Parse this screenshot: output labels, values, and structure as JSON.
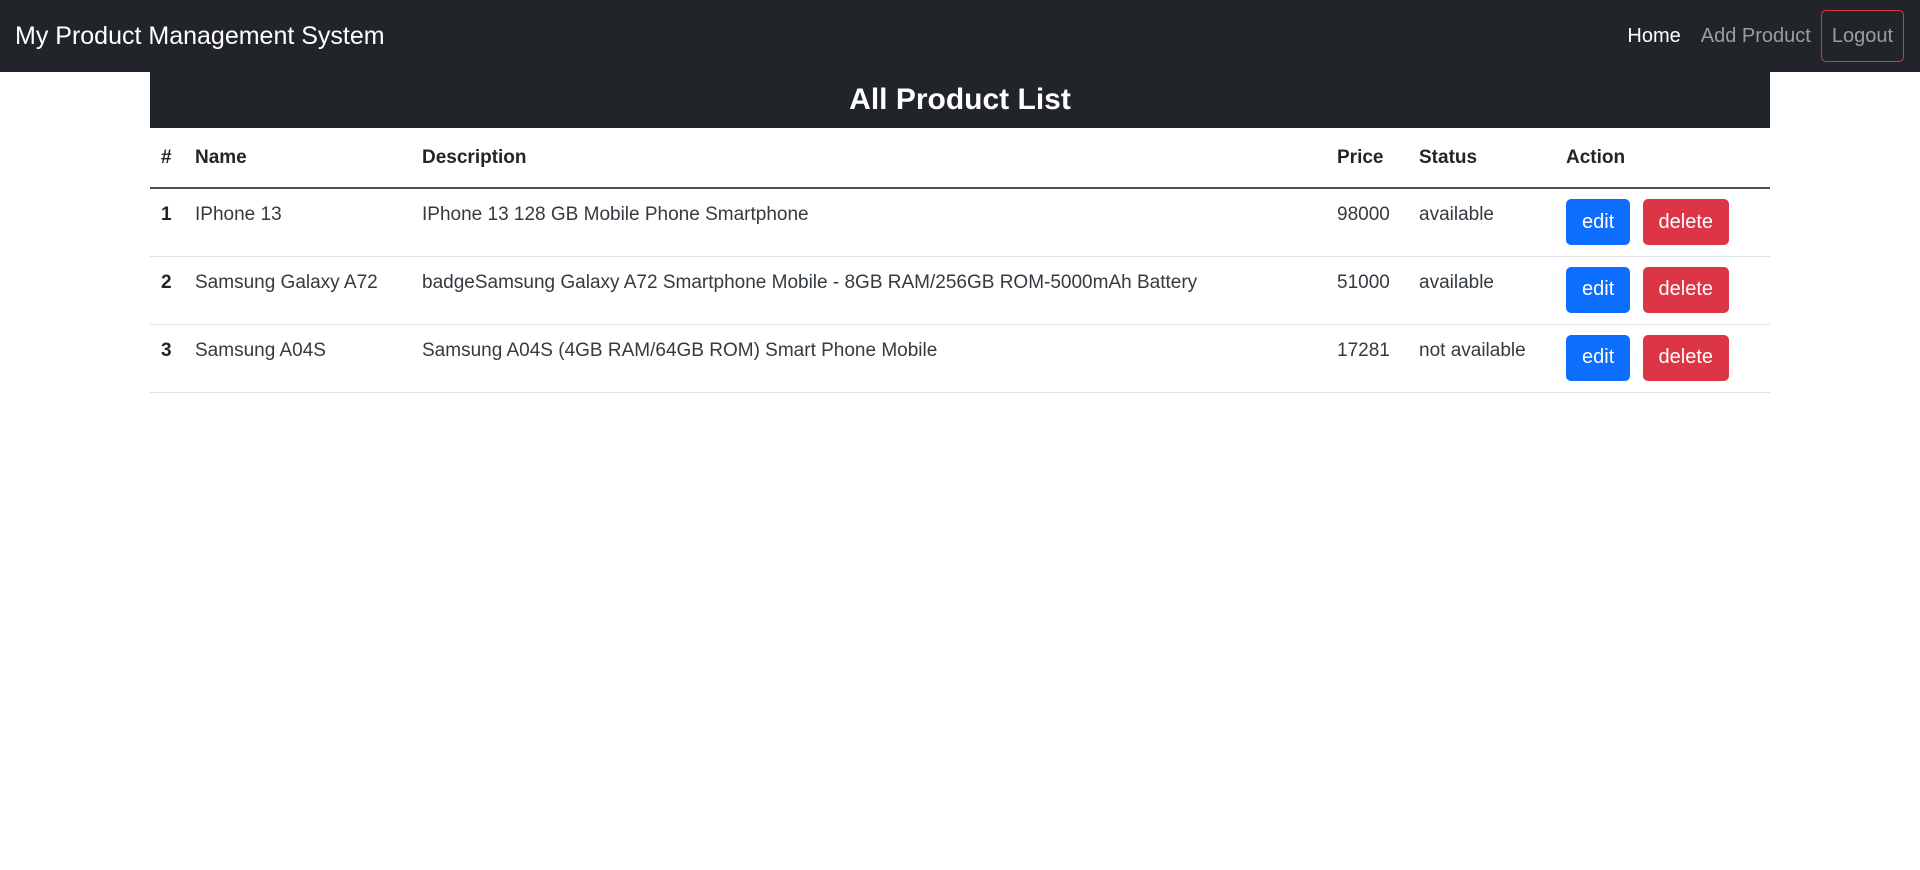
{
  "navbar": {
    "brand": "My Product Management System",
    "links": [
      {
        "label": "Home",
        "active": true
      },
      {
        "label": "Add Product",
        "active": false
      }
    ],
    "logout_label": "Logout",
    "colors": {
      "background": "#212529",
      "logout_border": "#dc3545"
    }
  },
  "main": {
    "title": "All Product List",
    "table": {
      "headers": {
        "num": "#",
        "name": "Name",
        "description": "Description",
        "price": "Price",
        "status": "Status",
        "action": "Action"
      },
      "rows": [
        {
          "num": "1",
          "name": "IPhone 13",
          "description": "IPhone 13 128 GB Mobile Phone Smartphone",
          "price": "98000",
          "status": "available",
          "edit_label": "edit",
          "delete_label": "delete"
        },
        {
          "num": "2",
          "name": "Samsung Galaxy A72",
          "description": "badgeSamsung Galaxy A72 Smartphone Mobile - 8GB RAM/256GB ROM-5000mAh Battery",
          "price": "51000",
          "status": "available",
          "edit_label": "edit",
          "delete_label": "delete"
        },
        {
          "num": "3",
          "name": "Samsung A04S",
          "description": "Samsung A04S (4GB RAM/64GB ROM) Smart Phone Mobile",
          "price": "17281",
          "status": "not available",
          "edit_label": "edit",
          "delete_label": "delete"
        }
      ]
    },
    "colors": {
      "edit_button": "#0d6efd",
      "delete_button": "#dc3545"
    }
  }
}
